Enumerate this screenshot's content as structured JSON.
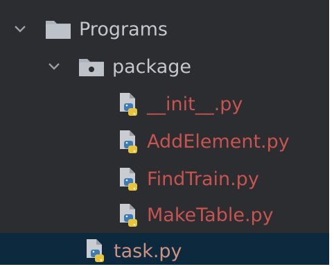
{
  "project_tree": {
    "root": {
      "label": "Programs",
      "icon": "folder-icon",
      "expanded": true
    },
    "package": {
      "label": "package",
      "icon": "package-folder-icon",
      "expanded": true,
      "files": [
        {
          "label": "__init__.py",
          "icon": "python-file-icon",
          "color": "#c75450"
        },
        {
          "label": "AddElement.py",
          "icon": "python-file-icon",
          "color": "#c75450"
        },
        {
          "label": "FindTrain.py",
          "icon": "python-file-icon",
          "color": "#c75450"
        },
        {
          "label": "MakeTable.py",
          "icon": "python-file-icon",
          "color": "#c75450"
        }
      ]
    },
    "task": {
      "label": "task.py",
      "icon": "python-file-icon",
      "selected": true,
      "color": "#d0927f"
    }
  },
  "colors": {
    "background": "#2b2d30",
    "selection": "#0d293e",
    "error_text": "#c75450",
    "folder_text": "#c4c7cc"
  }
}
